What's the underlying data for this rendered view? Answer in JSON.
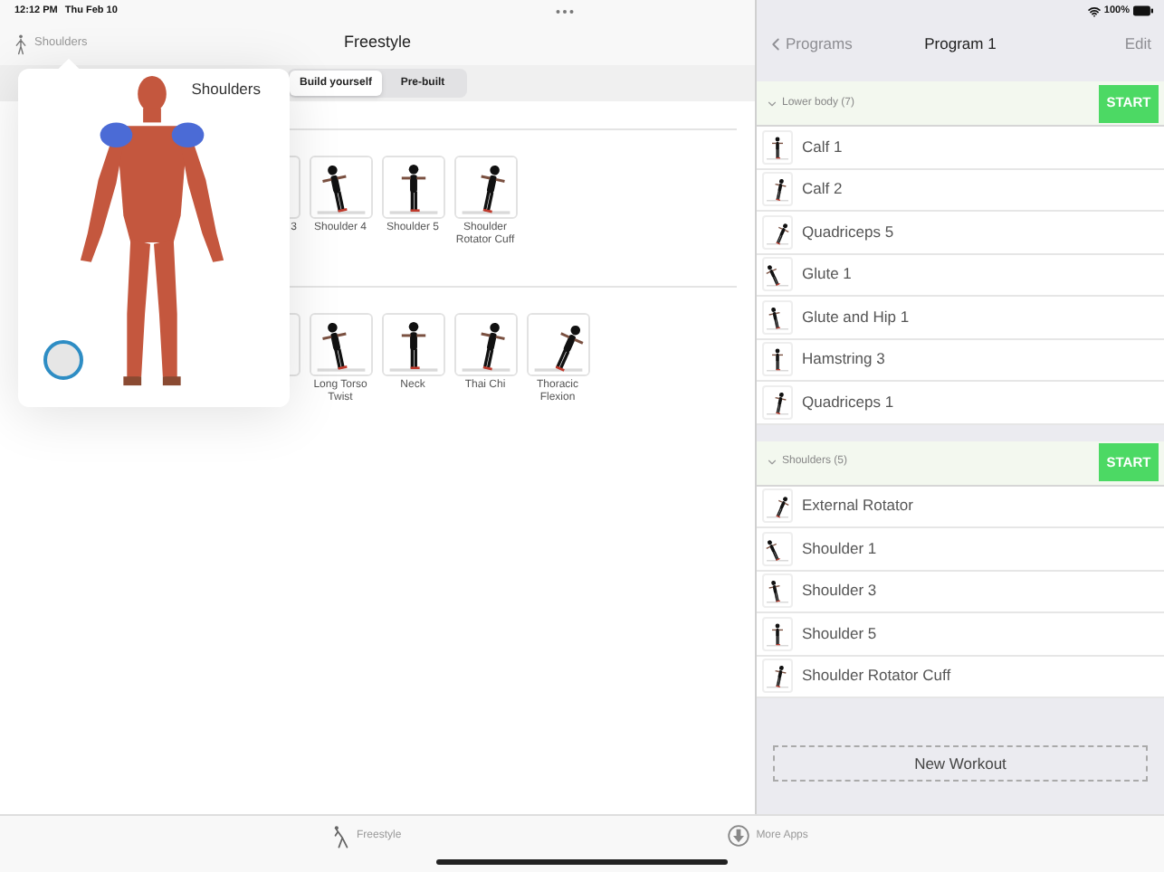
{
  "status_bar": {
    "time": "12:12 PM",
    "date": "Thu Feb 10",
    "battery": "100%"
  },
  "left_nav": {
    "back_label": "Shoulders",
    "title": "Freestyle"
  },
  "segments": [
    {
      "label": "Build yourself",
      "selected": true
    },
    {
      "label": "Pre-built",
      "selected": false
    }
  ],
  "exercise_rows": [
    {
      "tiles": [
        {
          "kind": "covered",
          "label": "3"
        },
        {
          "kind": "full",
          "label": "Shoulder 4"
        },
        {
          "kind": "full",
          "label": "Shoulder 5"
        },
        {
          "kind": "full",
          "label": "Shoulder Rotator Cuff"
        }
      ]
    },
    {
      "tiles": [
        {
          "kind": "covered"
        },
        {
          "kind": "full",
          "label": "Long Torso Twist"
        },
        {
          "kind": "full",
          "label": "Neck"
        },
        {
          "kind": "full",
          "label": "Thai Chi"
        },
        {
          "kind": "full",
          "label": "Thoracic Flexion"
        }
      ]
    }
  ],
  "popover": {
    "title": "Shoulders"
  },
  "right_nav": {
    "back_label": "Programs",
    "title": "Program 1",
    "action": "Edit"
  },
  "groups": [
    {
      "title": "Lower body (7)",
      "expanded": true,
      "button": "START",
      "items": [
        "Calf 1",
        "Calf 2",
        "Quadriceps 5",
        "Glute 1",
        "Glute and Hip 1",
        "Hamstring 3",
        "Quadriceps 1"
      ]
    },
    {
      "title": "Shoulders (5)",
      "expanded": true,
      "button": "START",
      "items": [
        "External Rotator",
        "Shoulder 1",
        "Shoulder 3",
        "Shoulder 5",
        "Shoulder Rotator Cuff"
      ]
    }
  ],
  "new_workout": "New Workout",
  "tab_bar": [
    {
      "label": "Freestyle",
      "kind": "figure"
    },
    {
      "label": "More Apps",
      "kind": "download"
    }
  ]
}
